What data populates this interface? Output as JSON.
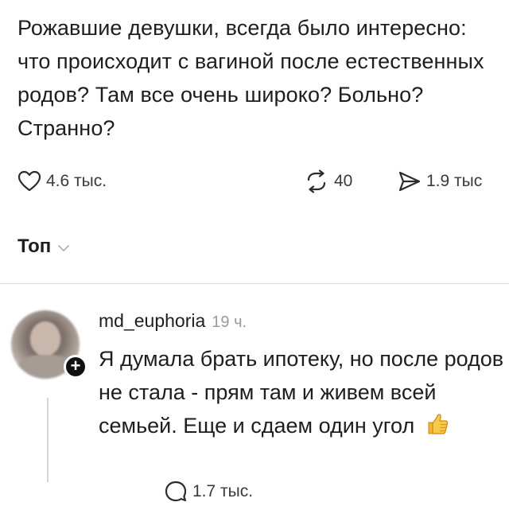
{
  "post": {
    "text": "Рожавшие девушки, всегда было интересно: что происходит с вагиной после естественных родов? Там все очень широко? Больно? Странно?"
  },
  "actions": {
    "likes": "4.6 тыс.",
    "comments": "1.7 тыс.",
    "reposts": "40",
    "shares": "1.9 тыс"
  },
  "sort": {
    "label": "Топ"
  },
  "comment": {
    "username": "md_euphoria",
    "time": "19 ч.",
    "text": "Я думала брать ипотеку, но после родов не стала - прям там и живем всей семьей. Еще и сдаем один угол",
    "emoji": "thumbs-up-icon"
  }
}
